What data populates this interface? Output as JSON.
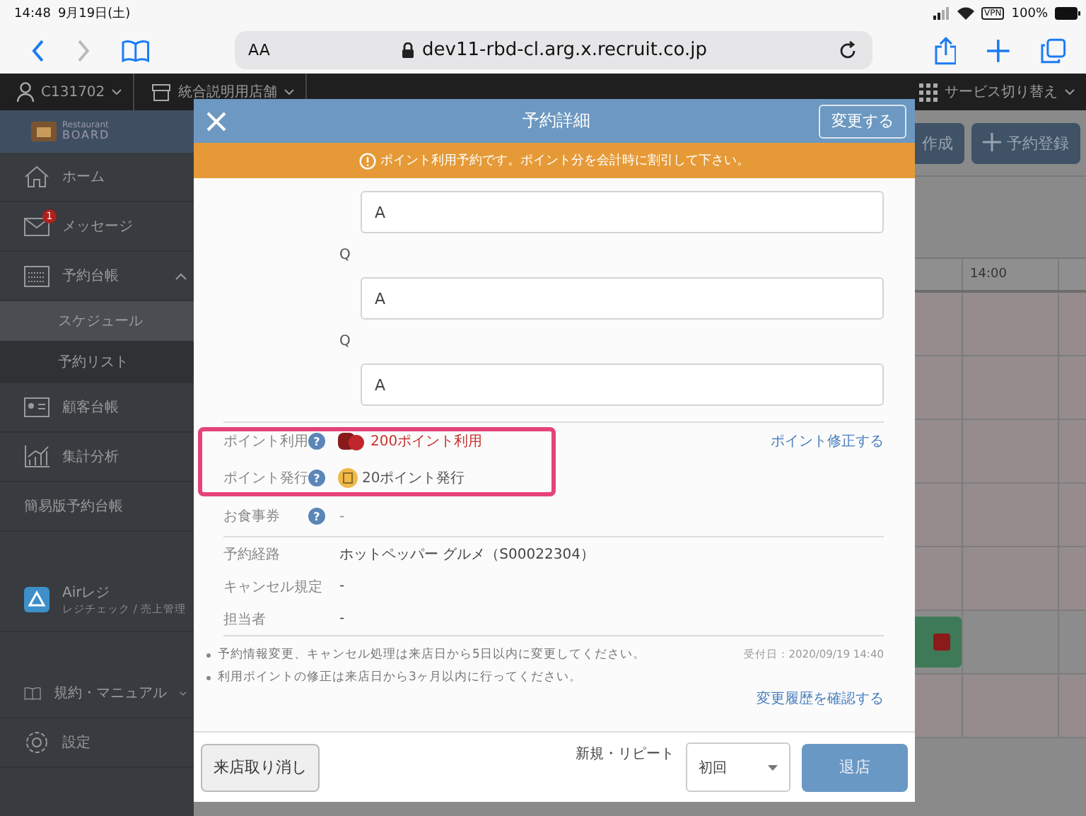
{
  "status_bar": {
    "time": "14:48",
    "date": "9月19日(土)",
    "vpn": "VPN",
    "battery": "100%"
  },
  "browser": {
    "text_size": "AA",
    "url": "dev11-rbd-cl.arg.x.recruit.co.jp"
  },
  "app_header": {
    "account": "C131702",
    "store": "統合説明用店舗",
    "service_switch": "サービス切り替え"
  },
  "logo": {
    "line1": "Restaurant",
    "line2": "BOARD"
  },
  "sidebar": {
    "items": [
      {
        "label": "ホーム",
        "selected": false
      },
      {
        "label": "メッセージ",
        "badge": "1",
        "selected": false
      },
      {
        "label": "予約台帳",
        "selected": false,
        "expanded": true,
        "children": [
          {
            "label": "スケジュール",
            "selected": true
          },
          {
            "label": "予約リスト",
            "selected": false
          }
        ]
      },
      {
        "label": "顧客台帳",
        "selected": false
      },
      {
        "label": "集計分析",
        "selected": false
      },
      {
        "label": "簡易版予約台帳",
        "selected": false
      },
      {
        "label": "Airレジ",
        "subtitle": "レジチェック / 売上管理",
        "selected": false
      },
      {
        "label": "規約・マニュアル",
        "selected": false,
        "expanded": false
      },
      {
        "label": "設定",
        "selected": false
      }
    ]
  },
  "toolbar_buttons": [
    "作成",
    "予約登録"
  ],
  "schedule": {
    "time_header": "14:00"
  },
  "modal": {
    "title": "予約詳細",
    "edit_button": "変更する",
    "notice": "ポイント利用予約です。ポイント分を会計時に割引して下さい。",
    "answers": [
      {
        "answer": "A"
      },
      {
        "question": "Q",
        "answer": "A"
      },
      {
        "question": "Q",
        "answer": "A"
      }
    ],
    "points": [
      {
        "kind": "use",
        "label": "ポイント利用",
        "help": "?",
        "value": "200ポイント利用"
      },
      {
        "kind": "issue",
        "label": "ポイント発行",
        "help": "?",
        "value": "20ポイント発行"
      }
    ],
    "point_edit_link": "ポイント修正する",
    "meal_ticket": {
      "label": "お食事券",
      "help": "?",
      "value": "-"
    },
    "details": [
      {
        "label": "予約経路",
        "value": "ホットペッパー グルメ（S00022304）"
      },
      {
        "label": "キャンセル規定",
        "value": "-"
      },
      {
        "label": "担当者",
        "value": "-"
      }
    ],
    "notes": [
      "予約情報変更、キャンセル処理は来店日から5日以内に変更してください。",
      "利用ポイントの修正は来店日から3ヶ月以内に行ってください。"
    ],
    "received": "受付日：2020/09/19 14:40",
    "history_link": "変更履歴を確認する",
    "footer": {
      "cancel_button": "来店取り消し",
      "repeat_label": "新規・リピート",
      "repeat_select": "初回",
      "checkout_button": "退店"
    }
  }
}
